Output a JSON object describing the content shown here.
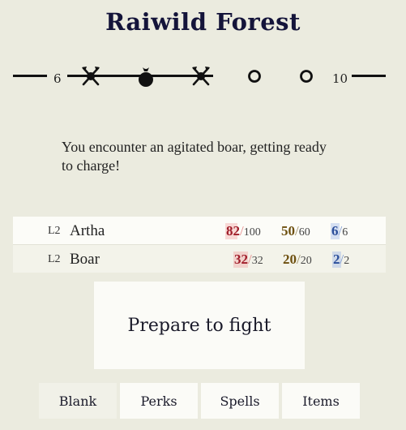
{
  "header": {
    "title": "Raiwild Forest"
  },
  "track": {
    "start_label": "6",
    "end_label": "10",
    "nodes": [
      {
        "icon": "crossed-axes-icon",
        "state": "visited"
      },
      {
        "icon": "loot-bag-icon",
        "state": "current"
      },
      {
        "icon": "crossed-axes-icon",
        "state": "visited"
      },
      {
        "icon": "empty-node-icon",
        "state": "unvisited"
      },
      {
        "icon": "empty-node-icon",
        "state": "unvisited"
      }
    ]
  },
  "message": "You encounter an agitated boar, getting ready to charge!",
  "combatants": [
    {
      "level": "L2",
      "name": "Artha",
      "hp": "82",
      "hp_max": "100",
      "hp_fraction": 0.82,
      "energy": "50",
      "energy_max": "60",
      "mana": "6",
      "mana_max": "6",
      "mana_fraction": 1.0
    },
    {
      "level": "L2",
      "name": "Boar",
      "hp": "32",
      "hp_max": "32",
      "hp_fraction": 1.0,
      "energy": "20",
      "energy_max": "20",
      "mana": "2",
      "mana_max": "2",
      "mana_fraction": 1.0
    }
  ],
  "action": {
    "label": "Prepare to fight"
  },
  "tabs": [
    {
      "label": "Blank",
      "active": true
    },
    {
      "label": "Perks",
      "active": false
    },
    {
      "label": "Spells",
      "active": false
    },
    {
      "label": "Items",
      "active": false
    }
  ],
  "colors": {
    "background": "#ebebdf",
    "hp": "#a01e2a",
    "energy": "#6d4f0e",
    "mana": "#2b4e9a"
  }
}
